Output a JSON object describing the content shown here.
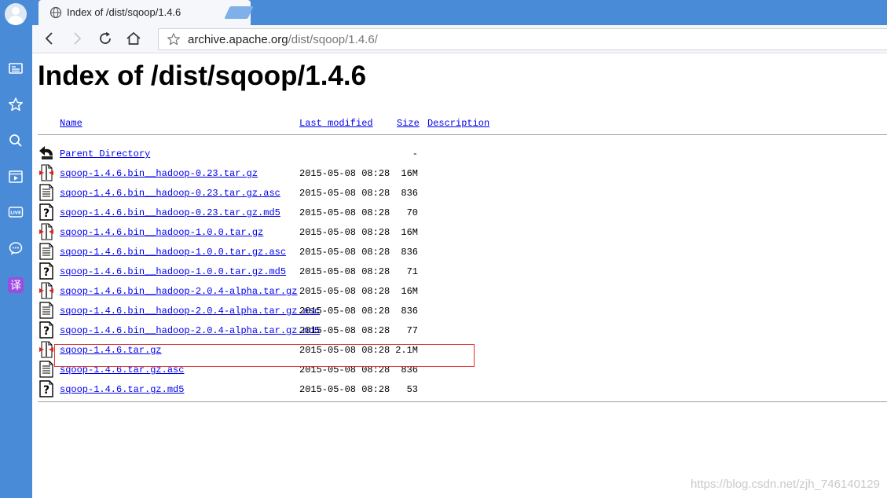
{
  "browser": {
    "tab": {
      "title": "Index of /dist/sqoop/1.4.6"
    },
    "address": {
      "host": "archive.apache.org",
      "path": "/dist/sqoop/1.4.6/"
    },
    "sidebar_icons": [
      "profile-card-icon",
      "star-icon",
      "search-icon",
      "video-icon",
      "live-icon",
      "chat-icon",
      "translate-icon"
    ],
    "sidebar_translate_glyph": "译"
  },
  "page": {
    "title": "Index of /dist/sqoop/1.4.6",
    "columns": {
      "name": "Name",
      "last_modified": "Last modified",
      "size": "Size",
      "description": "Description"
    },
    "entries": [
      {
        "name": "Parent Directory",
        "modified": "",
        "size": "-",
        "icon": "back-arrow-icon"
      },
      {
        "name": "sqoop-1.4.6.bin__hadoop-0.23.tar.gz",
        "modified": "2015-05-08 08:28",
        "size": "16M",
        "icon": "archive-file-icon"
      },
      {
        "name": "sqoop-1.4.6.bin__hadoop-0.23.tar.gz.asc",
        "modified": "2015-05-08 08:28",
        "size": "836",
        "icon": "text-file-icon"
      },
      {
        "name": "sqoop-1.4.6.bin__hadoop-0.23.tar.gz.md5",
        "modified": "2015-05-08 08:28",
        "size": "70",
        "icon": "unknown-file-icon"
      },
      {
        "name": "sqoop-1.4.6.bin__hadoop-1.0.0.tar.gz",
        "modified": "2015-05-08 08:28",
        "size": "16M",
        "icon": "archive-file-icon"
      },
      {
        "name": "sqoop-1.4.6.bin__hadoop-1.0.0.tar.gz.asc",
        "modified": "2015-05-08 08:28",
        "size": "836",
        "icon": "text-file-icon"
      },
      {
        "name": "sqoop-1.4.6.bin__hadoop-1.0.0.tar.gz.md5",
        "modified": "2015-05-08 08:28",
        "size": "71",
        "icon": "unknown-file-icon"
      },
      {
        "name": "sqoop-1.4.6.bin__hadoop-2.0.4-alpha.tar.gz",
        "modified": "2015-05-08 08:28",
        "size": "16M",
        "icon": "archive-file-icon"
      },
      {
        "name": "sqoop-1.4.6.bin__hadoop-2.0.4-alpha.tar.gz.asc",
        "modified": "2015-05-08 08:28",
        "size": "836",
        "icon": "text-file-icon"
      },
      {
        "name": "sqoop-1.4.6.bin__hadoop-2.0.4-alpha.tar.gz.md5",
        "modified": "2015-05-08 08:28",
        "size": "77",
        "icon": "unknown-file-icon"
      },
      {
        "name": "sqoop-1.4.6.tar.gz",
        "modified": "2015-05-08 08:28",
        "size": "2.1M",
        "icon": "archive-file-icon"
      },
      {
        "name": "sqoop-1.4.6.tar.gz.asc",
        "modified": "2015-05-08 08:28",
        "size": "836",
        "icon": "text-file-icon"
      },
      {
        "name": "sqoop-1.4.6.tar.gz.md5",
        "modified": "2015-05-08 08:28",
        "size": "53",
        "icon": "unknown-file-icon"
      }
    ],
    "highlighted_entry": "sqoop-1.4.6.bin__hadoop-2.0.4-alpha.tar.gz"
  },
  "watermark": "https://blog.csdn.net/zjh_746140129",
  "colors": {
    "chrome_blue": "#4a8bd8",
    "link": "#0000ee",
    "highlight_border": "#e03030"
  }
}
